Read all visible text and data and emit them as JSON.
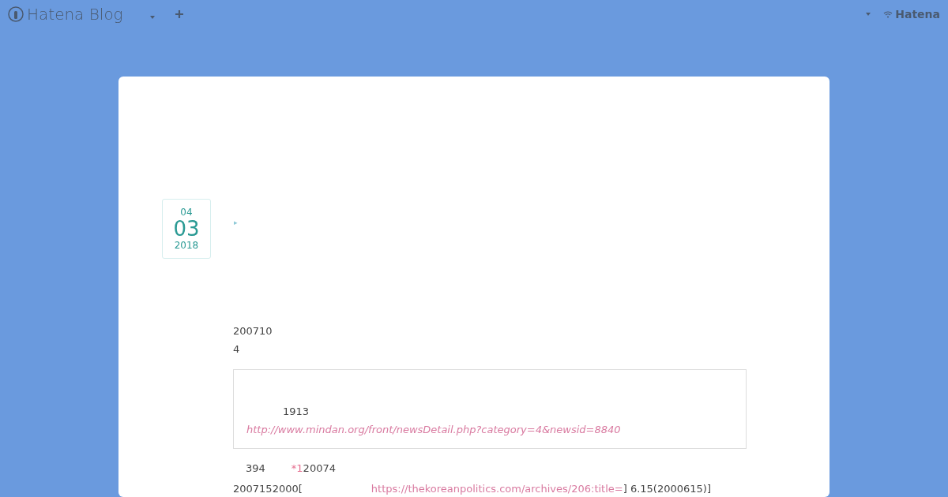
{
  "header": {
    "logo": "Hatena Blog",
    "right_logo": "Hatena"
  },
  "entry": {
    "date": {
      "month": "04",
      "day": "03",
      "year": "2018"
    },
    "marker": "▸",
    "lines": [
      "200710",
      "4"
    ],
    "quote": {
      "text": "1913",
      "link": "http://www.mindan.org/front/newsDetail.php?category=4&newsid=8840"
    },
    "note_line": {
      "text": "394",
      "footnote": "*1",
      "after": "20074"
    },
    "last_line": {
      "before": "2007152000[",
      "link": "https://thekoreanpolitics.com/archives/206:title=",
      "after": "] 6.15(2000615)]"
    }
  }
}
